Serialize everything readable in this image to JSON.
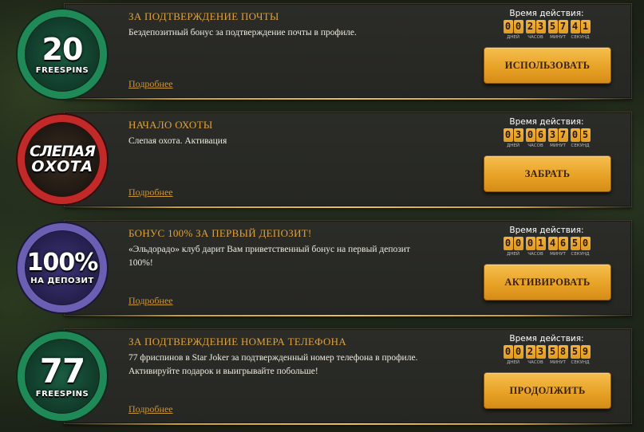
{
  "offers": [
    {
      "badge_number": "20",
      "badge_subtitle": "FREESPINS",
      "title": "ЗА ПОДТВЕРЖДЕНИЕ ПОЧТЫ",
      "description": "Бездепозитный бонус за подтверждение почты в профиле.",
      "more_label": "Подробнее",
      "timer_label": "Время действия:",
      "timer_digits": [
        "0",
        "0",
        "2",
        "3",
        "5",
        "7",
        "4",
        "1"
      ],
      "button_label": "ИСПОЛЬЗОВАТЬ"
    },
    {
      "badge_number": "СЛЕПАЯ",
      "badge_subtitle": "ОХОТА",
      "title": "НАЧАЛО ОХОТЫ",
      "description": "Слепая охота. Активация",
      "more_label": "Подробнее",
      "timer_label": "Время действия:",
      "timer_digits": [
        "0",
        "3",
        "0",
        "6",
        "3",
        "7",
        "0",
        "5"
      ],
      "button_label": "ЗАБРАТЬ"
    },
    {
      "badge_number": "100%",
      "badge_subtitle": "НА ДЕПОЗИТ",
      "title": "БОНУС 100% ЗА ПЕРВЫЙ ДЕПОЗИТ!",
      "description": "«Эльдорадо» клуб дарит Вам приветственный бонус на первый депозит 100%!",
      "more_label": "Подробнее",
      "timer_label": "Время действия:",
      "timer_digits": [
        "0",
        "0",
        "0",
        "1",
        "4",
        "6",
        "5",
        "0"
      ],
      "button_label": "АКТИВИРОВАТЬ"
    },
    {
      "badge_number": "77",
      "badge_subtitle": "FREESPINS",
      "title": "ЗА ПОДТВЕРЖДЕНИЕ НОМЕРА ТЕЛЕФОНА",
      "description": "77 фриспинов в Star Joker за подтвержденный номер телефона в профиле. Активируйте подарок и выигрывайте побольше!",
      "more_label": "Подробнее",
      "timer_label": "Время действия:",
      "timer_digits": [
        "0",
        "0",
        "2",
        "3",
        "5",
        "8",
        "5",
        "9"
      ],
      "button_label": "ПРОДОЛЖИТЬ"
    }
  ],
  "timer_units": [
    "ДНЕЙ",
    "ЧАСОВ",
    "МИНУТ",
    "СЕКУНД"
  ]
}
